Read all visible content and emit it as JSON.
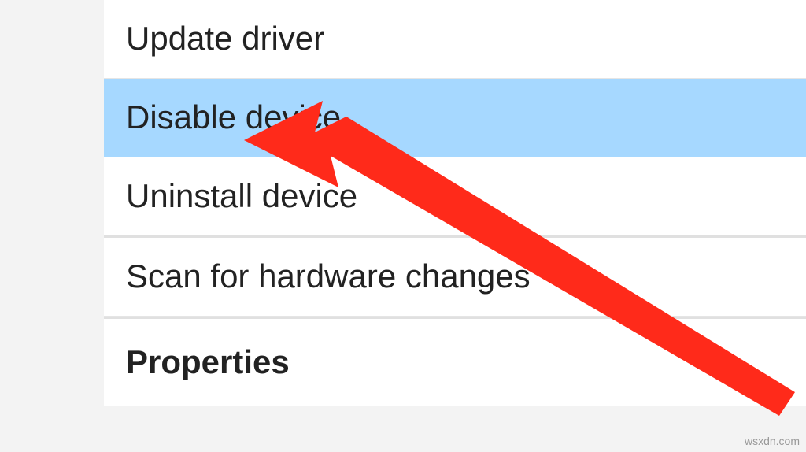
{
  "menu": {
    "items": [
      {
        "label": "Update driver",
        "highlighted": false
      },
      {
        "label": "Disable device",
        "highlighted": true
      },
      {
        "label": "Uninstall device",
        "highlighted": false
      },
      {
        "label": "Scan for hardware changes",
        "highlighted": false
      },
      {
        "label": "Properties",
        "highlighted": false
      }
    ]
  },
  "annotation": {
    "arrow_color": "#ff2a1a"
  },
  "watermark": {
    "text": "wsxdn.com"
  }
}
